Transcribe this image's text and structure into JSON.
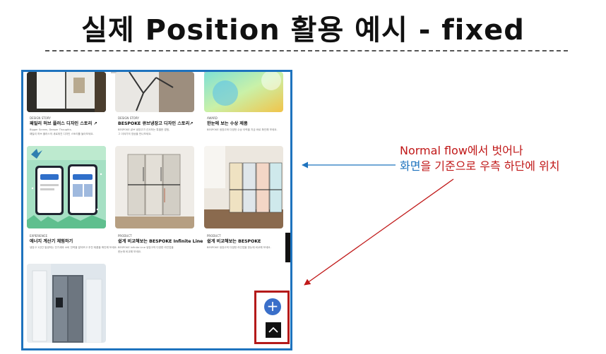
{
  "slide": {
    "title": "실제 Position 활용 예시 - fixed"
  },
  "screenshot": {
    "cards": [
      {
        "tag": "DESIGN STORY",
        "title": "패밀리 허브 플러스 디자인 스토리 ↗",
        "desc1": "Bigger Screen, Deeper Thoughts.",
        "desc2": "패밀리 허브 플러스의 새로워진 디자인 스토리를 들어보세요."
      },
      {
        "tag": "DESIGN STORY",
        "title": "BESPOKE 큐브냉장고 디자인 스토리↗",
        "desc1": "BESPOKE 큐브 냉장고가 선사하는 특별한 경험,",
        "desc2": "그 이야기의 영상을 만나보세요."
      },
      {
        "tag": "AWARD",
        "title": "한눈에 보는 수상 제품",
        "desc1": "BESPOKE 냉장고와 다양한 수상 이력을 지금 바로 확인해 보세요.",
        "desc2": ""
      },
      {
        "tag": "EXPERIENCE",
        "title": "에너지 계산기 체험하기",
        "desc1": "냉장고 1년간 발생하는 전기세와 소비 전력을 알아보고 추천 제품을 확인해 보세요.",
        "desc2": ""
      },
      {
        "tag": "PRODUCT",
        "title": "쉽게 비교해보는 BESPOKE Infinite Line",
        "desc1": "BESPOKE Infinite Line 냉장고의 다양한 라인업을",
        "desc2": "한눈에 비교해 보세요."
      },
      {
        "tag": "PRODUCT",
        "title": "쉽게 비교해보는 BESPOKE",
        "desc1": "BESPOKE 냉장고의 다양한 라인업을 한눈에 비교해 보세요.",
        "desc2": ""
      }
    ],
    "fab_plus": "+"
  },
  "callout": {
    "line1": "Normal flow에서 벗어나",
    "line2_highlight": "화면",
    "line2_rest": "을 기준으로 우측 하단에 위치"
  },
  "colors": {
    "frame": "#1e73be",
    "highlight_box": "#b41a1a",
    "callout_text": "#c01818",
    "callout_highlight": "#1e73be",
    "fab": "#3a6fc9"
  },
  "icons": {
    "fab": "plus-icon",
    "back_to_top": "chevron-up-icon"
  }
}
